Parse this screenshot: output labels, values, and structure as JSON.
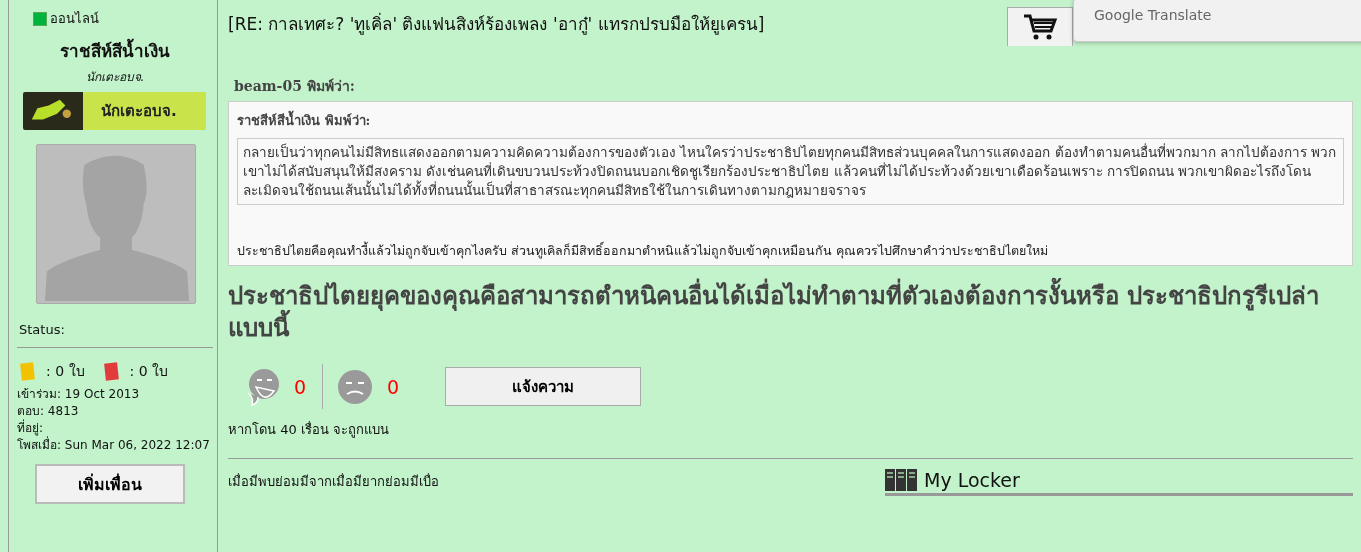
{
  "sidebar": {
    "online": {
      "label": "ออนไลน์",
      "color": "#00b33c"
    },
    "username": "ราชสีห์สีน้ำเงิน",
    "rank": "นักเตะอบจ.",
    "rank_badge": "นักเตะอบจ.",
    "status_label": "Status:",
    "cards": [
      {
        "kind": "yellow",
        "count": ": 0 ใบ"
      },
      {
        "kind": "red",
        "count": ": 0 ใบ"
      }
    ],
    "info": [
      "เข้าร่วม: 19 Oct 2013",
      "ตอบ: 4813",
      "ที่อยู่:",
      "โพสเมื่อ: Sun Mar 06, 2022 12:07"
    ],
    "add_friend": "เพิ่มเพื่อน"
  },
  "post": {
    "title": "[RE: กาลเทศะ? 'ทูเคิ่ล' ติงแฟนสิงห์ร้องเพลง 'อากู๋' แทรกปรบมือให้ยูเครน]",
    "quote": {
      "author": "beam-05 พิมพ์ว่า:",
      "inner_author": "ราชสีห์สีน้ำเงิน พิมพ์ว่า:",
      "inner_text": "กลายเป็นว่าทุกคนไม่มีสิทธแสดงออกตามความคิดความต้องการของตัวเอง ไหนใครว่าประชาธิปไตยทุกคนมีสิทธส่วนบุคคลในการแสดงออก ต้องทำตามคนอื่นที่พวกมาก ลากไปต้องการ พวกเขาไม่ได้สนับสนุนให้มีสงคราม ดังเช่นคนที่เดินขบวนประท้วงปิดถนนบอกเชิดชูเรียกร้องประชาธิปไตย แล้วคนที่ไม่ได้ประท้วงด้วยเขาเดือดร้อนเพราะ การปิดถนน พวกเขาผิดอะไรถึงโดนละเมิดจนใช้ถนนเส้นนั้นไม่ได้ทั้งที่ถนนนั้นเป็นที่สาธาสรณะทุกคนมีสิทธใช้ในการเดินทางตามกฎหมายจราจร",
      "text": "ประชาธิปไตยคือคุณทำงี้แล้วไม่ถูกจับเข้าคุกไงครับ ส่วนทูเคิลก็มีสิทธิ์ออกมาตำหนิแล้วไม่ถูกจับเข้าคุกเหมือนกัน คุณควรไปศึกษาคำว่าประชาธิปไตยใหม่"
    },
    "body": "ประชาธิปไตยยุคของคุณคือสามารถตำหนิคนอื่นได้เมื่อไม่ทำตามที่ตัวเองต้องการงั้นหรือ ประชาธิปกรูรีเปล่าแบบนี้",
    "reactions": [
      {
        "kind": "laugh",
        "count": "0"
      },
      {
        "kind": "sad",
        "count": "0"
      }
    ],
    "report_button": "แจ้งความ",
    "ban_note": "หากโดน 40 เรื่อน จะถูกแบน",
    "signature": "เมื่อมีพบย่อมมีจากเมื่อมียากย่อมมีเบื่อ"
  },
  "locker": {
    "title": "My Locker"
  },
  "translate_popup": {
    "title": "Google Translate"
  }
}
